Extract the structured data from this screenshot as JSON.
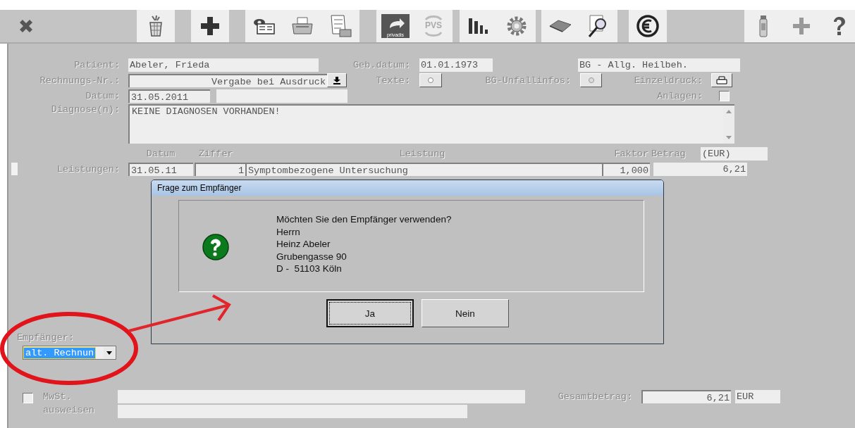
{
  "toolbar": {
    "groups": [
      {
        "buttons": [
          {
            "kind": "close"
          }
        ]
      },
      {
        "buttons": [
          {
            "kind": "trash"
          }
        ]
      },
      {
        "buttons": [
          {
            "kind": "plus"
          }
        ]
      },
      {
        "buttons": [
          {
            "kind": "card"
          },
          {
            "kind": "printer"
          },
          {
            "kind": "list"
          }
        ]
      },
      {
        "buttons": [
          {
            "kind": "privadis",
            "label": "privadis"
          },
          {
            "kind": "pvs",
            "label": "PVS"
          }
        ]
      },
      {
        "buttons": [
          {
            "kind": "chart"
          },
          {
            "kind": "gear"
          }
        ]
      },
      {
        "buttons": [
          {
            "kind": "eraser"
          },
          {
            "kind": "magnifier"
          }
        ]
      },
      {
        "buttons": [
          {
            "kind": "euro"
          }
        ]
      },
      {
        "buttons": [
          {
            "kind": "bottle"
          },
          {
            "kind": "add"
          },
          {
            "kind": "help"
          }
        ]
      }
    ]
  },
  "form": {
    "patient": {
      "label": "Patient:",
      "value": "Abeler, Frieda"
    },
    "birth_date": {
      "label": "Geb.datum:",
      "value": "01.01.1973"
    },
    "insurance": {
      "value": "BG - Allg. Heilbeh."
    },
    "invoice_no": {
      "label": "Rechnungs-Nr.:",
      "value": "Vergabe bei Ausdruck"
    },
    "texts": {
      "label": "Texte:"
    },
    "accident_info": {
      "label": "BG-Unfallinfos:"
    },
    "single_print": {
      "label": "Einzeldruck:"
    },
    "date": {
      "label": "Datum:",
      "value": "31.05.2011"
    },
    "attachments": {
      "label": "Anlagen:",
      "checked": false
    },
    "diagnoses": {
      "label": "Diagnose(n):",
      "value": "KEINE DIAGNOSEN VORHANDEN!"
    },
    "services": {
      "label": "Leistungen:",
      "columns": [
        "Datum",
        "Ziffer",
        "Leistung",
        "Faktor",
        "Betrag"
      ],
      "currency": "(EUR)",
      "rows": [
        {
          "date": "31.05.11",
          "code": "1",
          "service": "Symptombezogene Untersuchung",
          "factor": "1,000",
          "amount": "6,21"
        }
      ]
    },
    "recipient": {
      "label": "Empfänger:",
      "value": "alt. Rechnun",
      "text_selected": true
    },
    "vat": {
      "label": "MwSt. ausweisen",
      "checked": false
    },
    "total": {
      "label": "Gesamtbetrag:",
      "value": "6,21",
      "currency": "EUR"
    }
  },
  "dialog": {
    "title": "Frage zum Empfänger",
    "message": "Möchten Sie den Empfänger verwenden?\nHerrn\nHeinz Abeler\nGrubengasse 90\nD -  51103 Köln",
    "buttons": [
      {
        "label": "Ja",
        "default": true
      },
      {
        "label": "Nein",
        "default": false
      }
    ]
  }
}
